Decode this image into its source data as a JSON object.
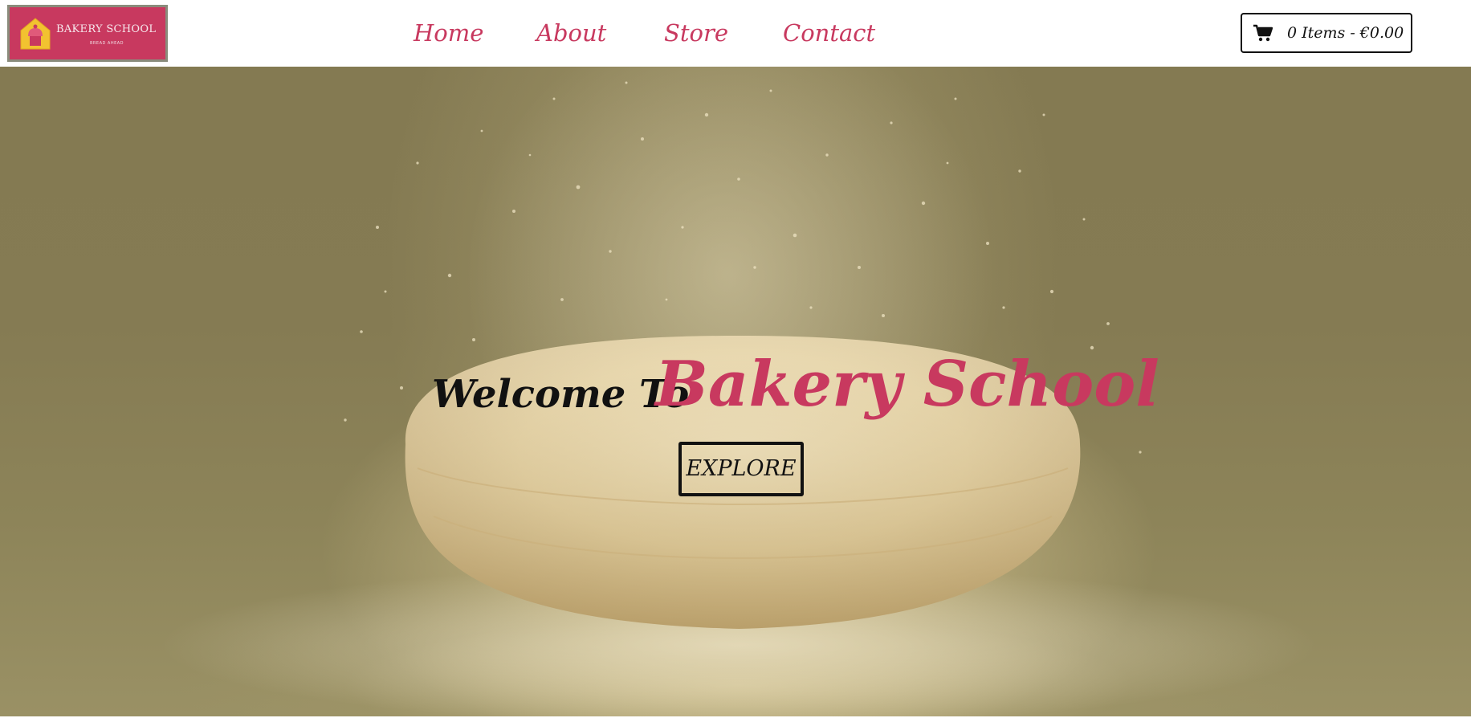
{
  "header": {
    "logo": {
      "title": "BAKERY SCHOOL",
      "subtitle": "BREAD AHEAD",
      "icon": "cupcake-house-icon"
    },
    "nav": [
      {
        "label": "Home"
      },
      {
        "label": "About"
      },
      {
        "label": "Store"
      },
      {
        "label": "Contact"
      }
    ],
    "cart": {
      "icon": "shopping-cart-icon",
      "label": "0 Items - €0.00"
    }
  },
  "hero": {
    "welcome_prefix": "Welcome To",
    "welcome_brand": "Bakery School",
    "button_label": "EXPLORE",
    "background": "flour-dusted-bread-photo"
  },
  "colors": {
    "brand": "#c8395f",
    "text": "#111111",
    "hero_bg": "#857b53",
    "logo_border": "#8a8c7c"
  }
}
